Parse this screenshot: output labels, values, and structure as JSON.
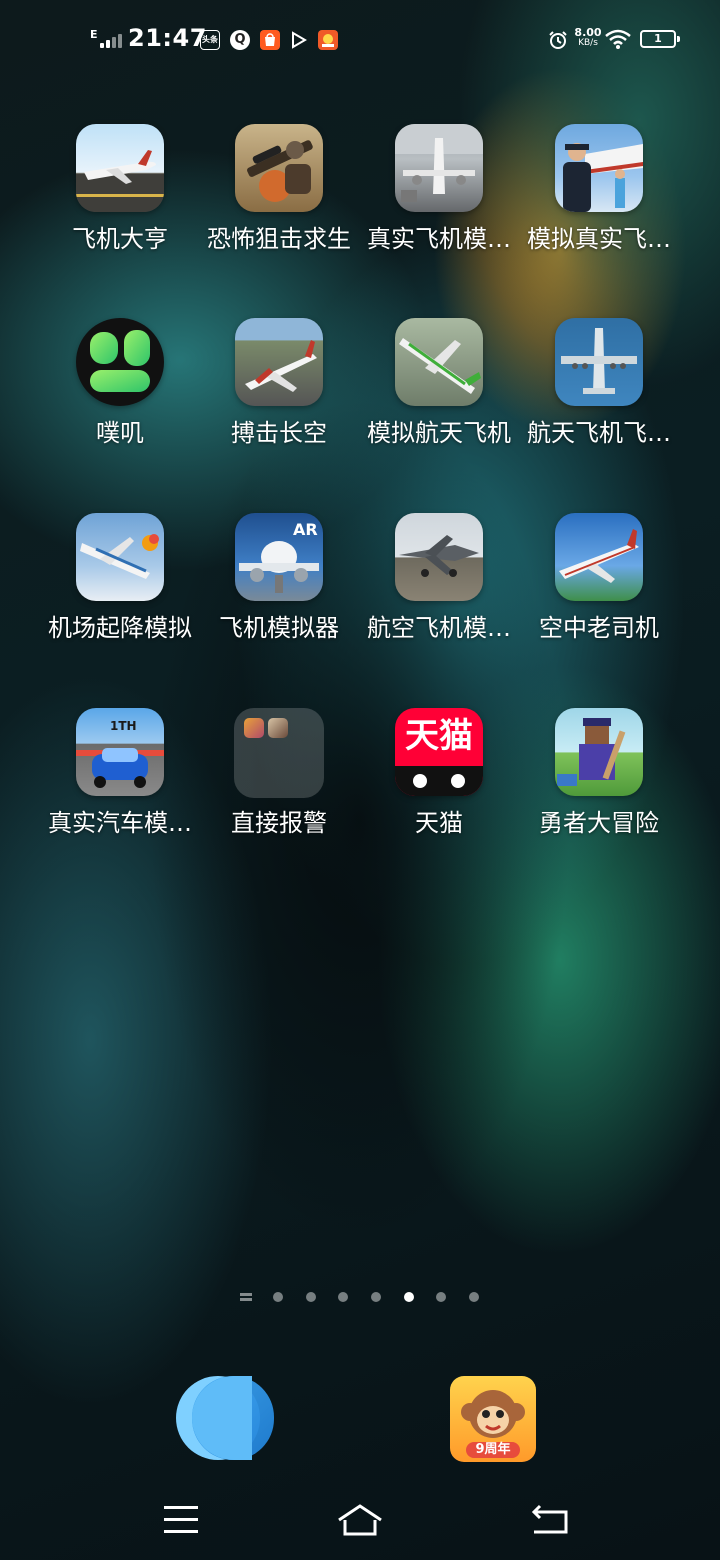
{
  "status_bar": {
    "network_type": "E",
    "time": "21:47",
    "notification_icons": [
      {
        "name": "toutiao-icon",
        "text": "头条",
        "color": "#e63c3c"
      },
      {
        "name": "browser-q-icon",
        "text": "Q",
        "color": "#3a7bd5"
      },
      {
        "name": "shop-icon",
        "text": "",
        "color": "#ff5a1f"
      },
      {
        "name": "video-play-icon",
        "text": "▶",
        "color": "#2a2a2a"
      },
      {
        "name": "game-app-icon",
        "text": "",
        "color": "#f05a28"
      }
    ],
    "net_speed_value": "8.00",
    "net_speed_unit": "KB/s",
    "battery_level": "1"
  },
  "apps": [
    {
      "label": "飞机大亨"
    },
    {
      "label": "恐怖狙击求生"
    },
    {
      "label": "真实飞机模…"
    },
    {
      "label": "模拟真实飞…"
    },
    {
      "label": "噗叽"
    },
    {
      "label": "搏击长空"
    },
    {
      "label": "模拟航天飞机"
    },
    {
      "label": "航天飞机飞…"
    },
    {
      "label": "机场起降模拟"
    },
    {
      "label": "飞机模拟器"
    },
    {
      "label": "航空飞机模…"
    },
    {
      "label": "空中老司机"
    },
    {
      "label": "真实汽车模…"
    },
    {
      "label": "直接报警"
    },
    {
      "label": "天猫"
    },
    {
      "label": "勇者大冒险"
    }
  ],
  "app_icon_text": {
    "race_badge": "1TH",
    "tmall_text": "天猫",
    "ar_badge": "AR",
    "dock_anniversary": "9周年"
  },
  "page_indicator": {
    "count": 7,
    "active_index": 4
  },
  "colors": {
    "accent_blue": "#4fb6f5",
    "tmall_red": "#ff0036"
  }
}
